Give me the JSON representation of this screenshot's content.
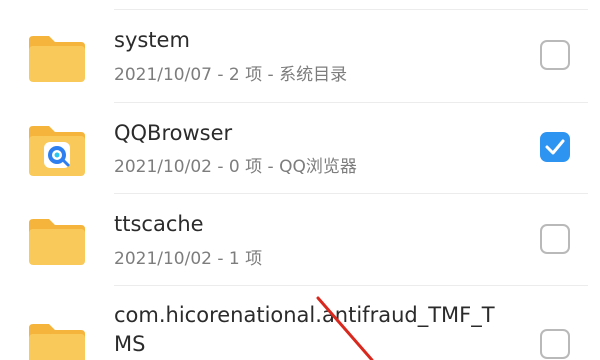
{
  "files": [
    {
      "name": "system",
      "meta": "2021/10/07 - 2 项 - 系统目录",
      "checked": false,
      "badge": null
    },
    {
      "name": "QQBrowser",
      "meta": "2021/10/02 - 0 项 - QQ浏览器",
      "checked": true,
      "badge": "qq-browser-logo"
    },
    {
      "name": "ttscache",
      "meta": "2021/10/02 - 1 项",
      "checked": false,
      "badge": null
    },
    {
      "name": "com.hicorenational.antifraud_TMF_TMS",
      "name_display": "com.hicorenational.antifraud_TMF_T\nMS",
      "meta": "",
      "checked": false,
      "badge": null
    }
  ],
  "colors": {
    "folder": "#f9c95a",
    "folder_tab": "#f5b53c",
    "checkbox_checked": "#2e94f2",
    "checkbox_border": "#b9b9b9",
    "annotation_line": "#d9291e"
  },
  "icons": {
    "folder": "folder-icon",
    "check": "check-icon"
  }
}
